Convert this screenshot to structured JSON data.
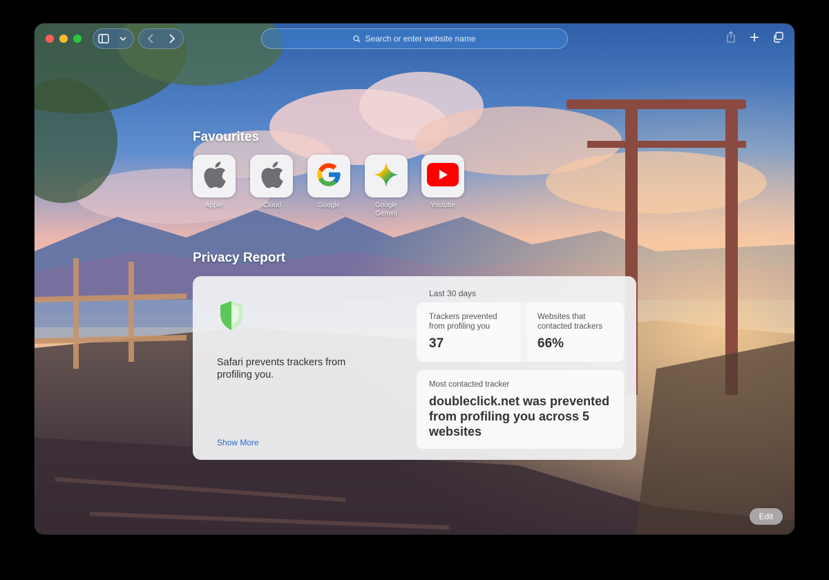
{
  "toolbar": {
    "address_placeholder": "Search or enter website name"
  },
  "favourites": {
    "title": "Favourites",
    "items": [
      {
        "label": "Apple",
        "icon": "apple-logo-icon"
      },
      {
        "label": "iCloud",
        "icon": "apple-logo-icon"
      },
      {
        "label": "Google",
        "icon": "google-g-icon"
      },
      {
        "label": "Google\nGemini",
        "icon": "gemini-star-icon"
      },
      {
        "label": "Youtube",
        "icon": "youtube-play-icon"
      }
    ]
  },
  "privacy": {
    "title": "Privacy Report",
    "message": "Safari prevents trackers from profiling you.",
    "show_more": "Show More",
    "period": "Last 30 days",
    "trackers_label": "Trackers prevented from profiling you",
    "trackers_value": "37",
    "websites_label": "Websites that contacted trackers",
    "websites_value": "66%",
    "most_contacted_label": "Most contacted tracker",
    "most_contacted_text": "doubleclick.net was prevented from profiling you across 5 websites"
  },
  "footer": {
    "edit_label": "Edit"
  },
  "colors": {
    "accent": "#2a6fd1",
    "shield_green": "#5cc85a",
    "youtube_red": "#ff0000"
  }
}
